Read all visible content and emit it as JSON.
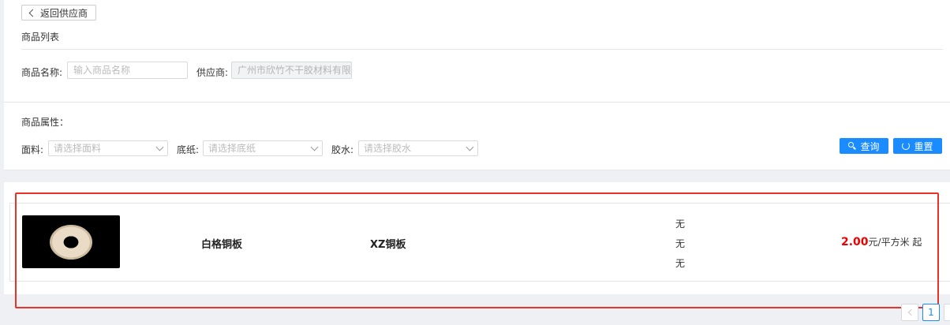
{
  "header": {
    "back_label": "返回供应商",
    "section_title": "商品列表"
  },
  "filters": {
    "name_label": "商品名称:",
    "name_placeholder": "输入商品名称",
    "supplier_label": "供应商:",
    "supplier_value": "广州市欣竹不干胶材料有限公司"
  },
  "attributes": {
    "title": "商品属性：",
    "face_label": "面料:",
    "face_placeholder": "请选择面料",
    "backing_label": "底纸:",
    "backing_placeholder": "请选择底纸",
    "glue_label": "胶水:",
    "glue_placeholder": "请选择胶水",
    "search_label": "查询",
    "reset_label": "重置"
  },
  "products": [
    {
      "image_icon": "tape-roll-image",
      "name": "白格铜板",
      "material": "XZ铜板",
      "attrs": [
        "无",
        "无",
        "无"
      ],
      "price_value": "2.00",
      "price_unit": "元/平方米 起"
    }
  ],
  "pagination": {
    "current_page": "1"
  },
  "colors": {
    "primary": "#1a8cff",
    "price": "#e00000",
    "highlight": "#e8332a"
  }
}
